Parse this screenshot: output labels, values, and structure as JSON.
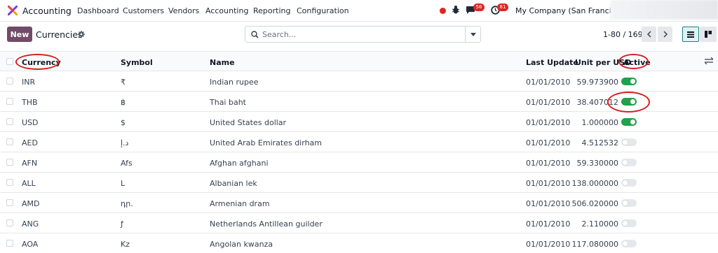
{
  "nav": {
    "app_name": "Accounting",
    "menu": [
      "Dashboard",
      "Customers",
      "Vendors",
      "Accounting",
      "Reporting",
      "Configuration"
    ],
    "chat_badge": "56",
    "activity_badge": "81",
    "company": "My Company (San Francisco)"
  },
  "control": {
    "new_label": "New",
    "title": "Currencies",
    "search_placeholder": "Search...",
    "pager": "1-80 / 169"
  },
  "table": {
    "headers": {
      "currency": "Currency",
      "symbol": "Symbol",
      "name": "Name",
      "last_update": "Last Update",
      "unit_per_usd": "Unit per USD",
      "active": "Active"
    },
    "rows": [
      {
        "currency": "INR",
        "symbol": "₹",
        "name": "Indian rupee",
        "last_update": "01/01/2010",
        "unit_per_usd": "59.973900",
        "active": true
      },
      {
        "currency": "THB",
        "symbol": "฿",
        "name": "Thai baht",
        "last_update": "01/01/2010",
        "unit_per_usd": "38.407012",
        "active": true
      },
      {
        "currency": "USD",
        "symbol": "$",
        "name": "United States dollar",
        "last_update": "01/01/2010",
        "unit_per_usd": "1.000000",
        "active": true
      },
      {
        "currency": "AED",
        "symbol": "د.إ",
        "name": "United Arab Emirates dirham",
        "last_update": "01/01/2010",
        "unit_per_usd": "4.512532",
        "active": false
      },
      {
        "currency": "AFN",
        "symbol": "Afs",
        "name": "Afghan afghani",
        "last_update": "01/01/2010",
        "unit_per_usd": "59.330000",
        "active": false
      },
      {
        "currency": "ALL",
        "symbol": "L",
        "name": "Albanian lek",
        "last_update": "01/01/2010",
        "unit_per_usd": "138.000000",
        "active": false
      },
      {
        "currency": "AMD",
        "symbol": "դր.",
        "name": "Armenian dram",
        "last_update": "01/01/2010",
        "unit_per_usd": "506.020000",
        "active": false
      },
      {
        "currency": "ANG",
        "symbol": "ƒ",
        "name": "Netherlands Antillean guilder",
        "last_update": "01/01/2010",
        "unit_per_usd": "2.110000",
        "active": false
      },
      {
        "currency": "AOA",
        "symbol": "Kz",
        "name": "Angolan kwanza",
        "last_update": "01/01/2010",
        "unit_per_usd": "117.080000",
        "active": false
      }
    ]
  },
  "colors": {
    "brand": "#714b67",
    "toggle_on": "#22a04b",
    "badge": "#e02424",
    "annotation": "#d71f1f"
  },
  "icons": [
    "app-logo-icon",
    "record-icon",
    "bug-icon",
    "chat-icon",
    "clock-icon",
    "gear-icon",
    "search-icon",
    "chevron-down-icon",
    "chevron-left-icon",
    "chevron-right-icon",
    "list-view-icon",
    "kanban-view-icon",
    "column-settings-icon"
  ]
}
